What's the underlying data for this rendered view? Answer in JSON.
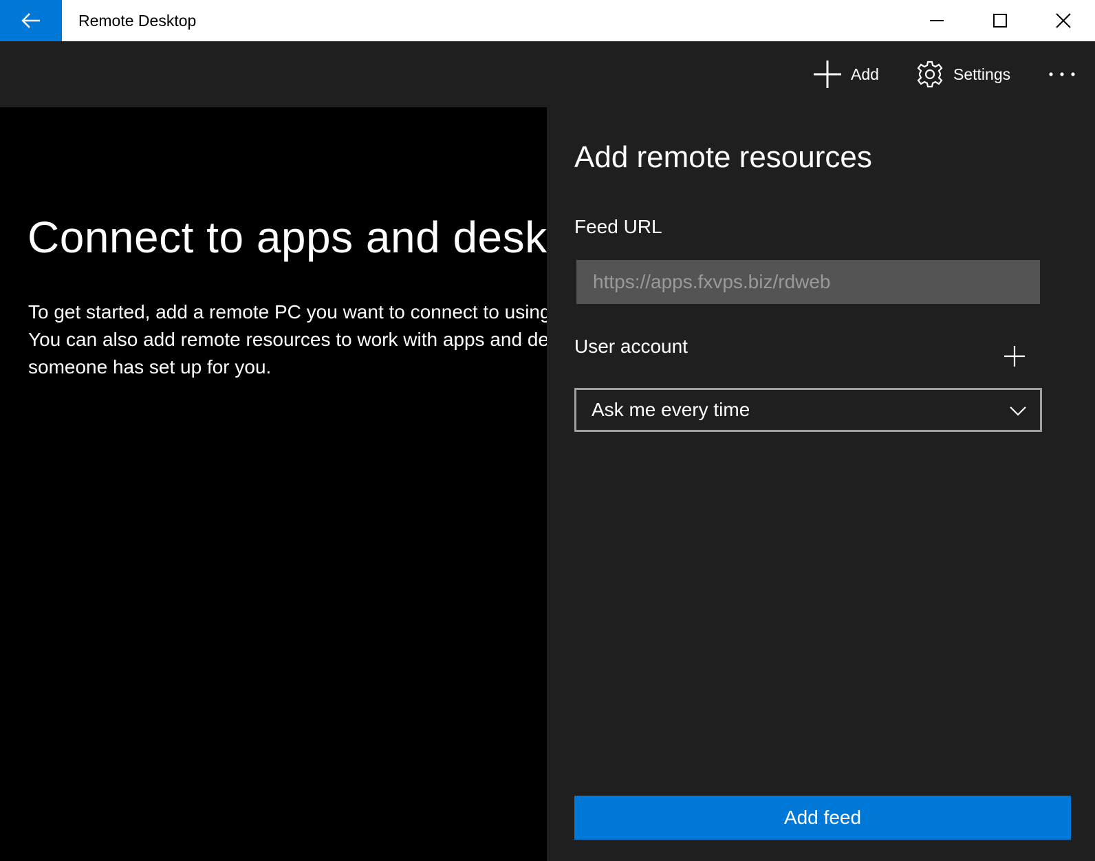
{
  "window": {
    "title": "Remote Desktop"
  },
  "icons": {
    "back": "arrow-left-icon",
    "minimize": "minimize-icon",
    "maximize": "maximize-icon",
    "close": "close-icon",
    "add": "plus-icon",
    "settings": "gear-icon",
    "more": "more-ellipsis-icon",
    "chevron": "chevron-down-icon"
  },
  "colors": {
    "accent": "#0078d7",
    "panel_bg": "#1f1f1f",
    "main_bg": "#000000",
    "input_bg": "#545454"
  },
  "commandbar": {
    "add_label": "Add",
    "settings_label": "Settings"
  },
  "main": {
    "title": "Connect to apps and desktops",
    "description": [
      "To get started, add a remote PC you want to connect to using",
      "You can also add remote resources to work with apps and desktops",
      "someone has set up for you."
    ]
  },
  "panel": {
    "title": "Add remote resources",
    "feed_url_label": "Feed URL",
    "feed_url_value": "",
    "feed_url_placeholder": "https://apps.fxvps.biz/rdweb",
    "user_account_label": "User account",
    "user_account_selected": "Ask me every time",
    "add_feed_label": "Add feed"
  }
}
